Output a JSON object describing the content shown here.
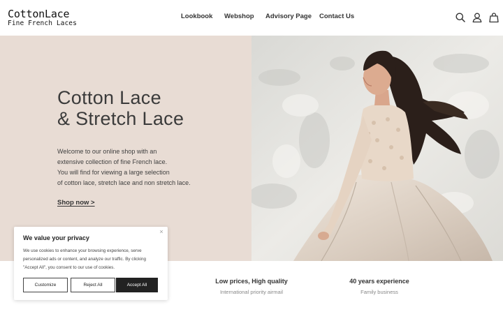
{
  "brand": {
    "title": "CottonLace",
    "subtitle": "Fine French Laces"
  },
  "nav": {
    "items": [
      {
        "label": "Lookbook"
      },
      {
        "label": "Webshop"
      },
      {
        "label": "Advisory Page"
      },
      {
        "label": "Contact Us"
      }
    ]
  },
  "header_icons": [
    "search-icon",
    "account-icon",
    "cart-bag-icon"
  ],
  "hero": {
    "title_line1": "Cotton Lace",
    "title_line2": "& Stretch Lace",
    "text_lines": [
      "Welcome to our online shop with an",
      "extensive collection of fine French lace.",
      "You will find for viewing a large selection",
      "of cotton lace, stretch lace and non stretch lace."
    ],
    "cta": "Shop now >",
    "image_alt": "woman in lace dress"
  },
  "features": [
    {
      "title": "Low prices, High quality",
      "subtitle": "International priority airmail"
    },
    {
      "title": "40 years experience",
      "subtitle": "Family business"
    }
  ],
  "cookie": {
    "title": "We value your privacy",
    "text_lines": [
      "We use cookies to enhance your browsing experience, serve",
      "personalized ads or content, and analyze our traffic. By clicking",
      "\"Accept All\", you consent to our use of cookies."
    ],
    "close": "×",
    "customize": "Customize",
    "reject": "Reject All",
    "accept": "Accept All"
  },
  "colors": {
    "hero_bg": "#e8dcd4",
    "text_dark": "#333333",
    "button_dark": "#222222"
  }
}
